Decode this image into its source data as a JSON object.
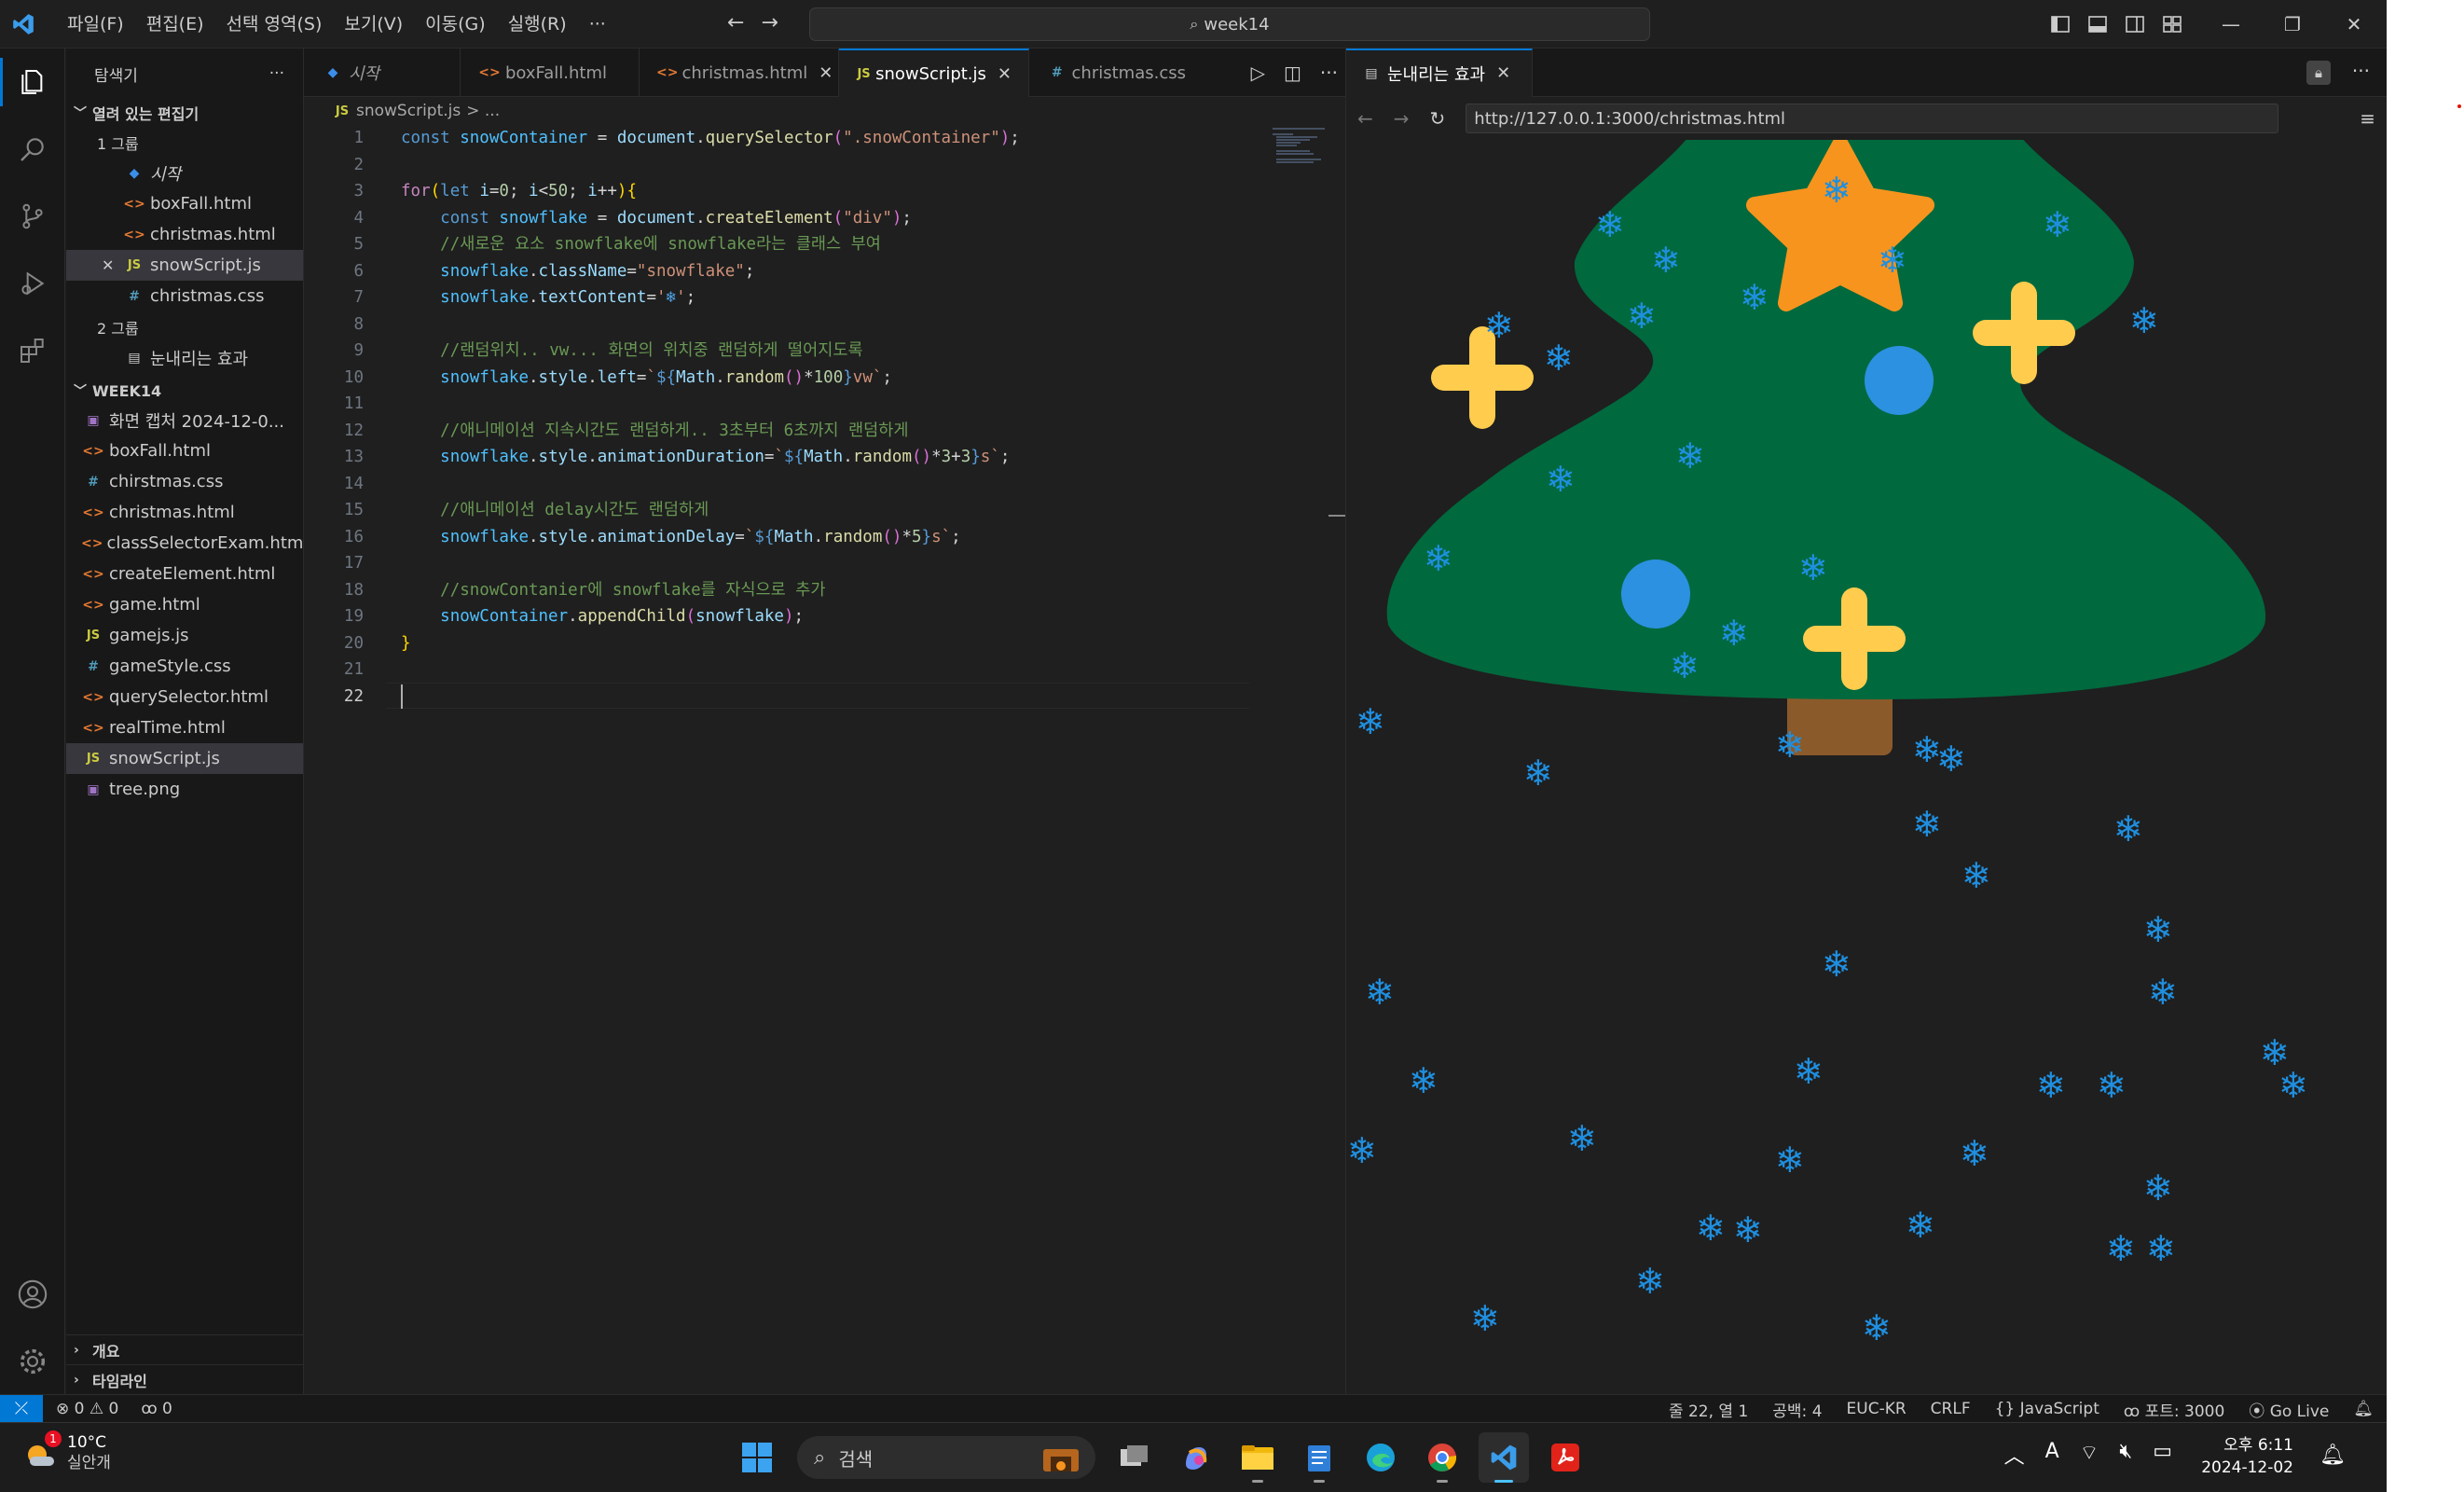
{
  "titlebar": {
    "menu": [
      "파일(F)",
      "편집(E)",
      "선택 영역(S)",
      "보기(V)",
      "이동(G)",
      "실행(R)",
      "···"
    ],
    "search": "week14"
  },
  "sidebar": {
    "title": "탐색기",
    "more": "···",
    "open_editors_label": "열려 있는 편집기",
    "group1_label": "1 그룹",
    "group1_items": [
      {
        "icon": "vscode",
        "label": "시작",
        "italic": true
      },
      {
        "icon": "html",
        "label": "boxFall.html"
      },
      {
        "icon": "html",
        "label": "christmas.html"
      },
      {
        "icon": "js",
        "label": "snowScript.js",
        "selected": true,
        "close": "✕"
      },
      {
        "icon": "css",
        "label": "christmas.css"
      }
    ],
    "group2_label": "2 그룹",
    "group2_items": [
      {
        "icon": "preview",
        "label": "눈내리는 효과"
      }
    ],
    "folder_label": "WEEK14",
    "files": [
      {
        "icon": "img",
        "label": "화면 캡처 2024-12-0..."
      },
      {
        "icon": "html",
        "label": "boxFall.html"
      },
      {
        "icon": "css",
        "label": "chirstmas.css"
      },
      {
        "icon": "html",
        "label": "christmas.html"
      },
      {
        "icon": "html",
        "label": "classSelectorExam.html"
      },
      {
        "icon": "html",
        "label": "createElement.html"
      },
      {
        "icon": "html",
        "label": "game.html"
      },
      {
        "icon": "js",
        "label": "gamejs.js"
      },
      {
        "icon": "css",
        "label": "gameStyle.css"
      },
      {
        "icon": "html",
        "label": "querySelector.html"
      },
      {
        "icon": "html",
        "label": "realTime.html"
      },
      {
        "icon": "js",
        "label": "snowScript.js",
        "selected": true
      },
      {
        "icon": "img",
        "label": "tree.png"
      }
    ],
    "outline_label": "개요",
    "timeline_label": "타임라인"
  },
  "editor": {
    "tabs": [
      {
        "icon": "vscode",
        "label": "시작"
      },
      {
        "icon": "html",
        "label": "boxFall.html"
      },
      {
        "icon": "html",
        "label": "christmas.html",
        "close": "✕"
      },
      {
        "icon": "js",
        "label": "snowScript.js",
        "close": "✕",
        "active": true
      },
      {
        "icon": "css",
        "label": "christmas.css"
      }
    ],
    "breadcrumb_file": "snowScript.js",
    "breadcrumb_rest": "> ...",
    "line_numbers": [
      "1",
      "2",
      "3",
      "4",
      "5",
      "6",
      "7",
      "8",
      "9",
      "10",
      "11",
      "12",
      "13",
      "14",
      "15",
      "16",
      "17",
      "18",
      "19",
      "20",
      "21",
      "22"
    ],
    "current_line": "22"
  },
  "preview": {
    "tab_label": "눈내리는 효과",
    "tab_close": "✕",
    "url": "http://127.0.0.1:3000/christmas.html",
    "snowflake_char": "❄"
  },
  "statusbar": {
    "errors": "⊗ 0 ⚠ 0",
    "ports_left": "ꝏ 0",
    "position": "줄 22, 열 1",
    "spaces": "공백: 4",
    "encoding": "EUC-KR",
    "eol": "CRLF",
    "language": "{} JavaScript",
    "ports": "포트: 3000",
    "golive": "Go Live"
  },
  "taskbar": {
    "temp": "10°C",
    "weather": "실안개",
    "badge": "1",
    "search_placeholder": "검색",
    "time": "오후 6:11",
    "date": "2024-12-02",
    "ime": "A"
  },
  "colors": {
    "accent": "#0078d4",
    "tree": "#00693e",
    "trunk": "#8b5a2b",
    "star": "#f7941d",
    "cross": "#ffcc4d",
    "ornament": "#2b91e0",
    "snow": "#1f8fe0"
  }
}
